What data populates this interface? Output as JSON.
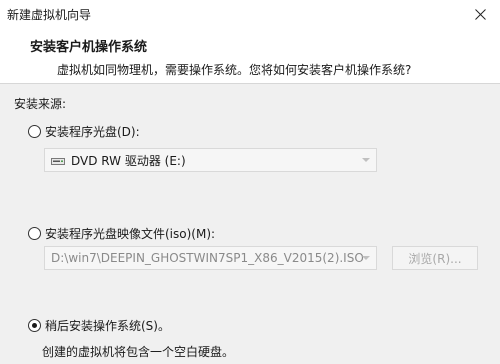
{
  "window": {
    "title": "新建虚拟机向导"
  },
  "header": {
    "title": "安装客户机操作系统",
    "subtitle": "虚拟机如同物理机，需要操作系统。您将如何安装客户机操作系统?"
  },
  "source": {
    "label": "安装来源:",
    "options": [
      {
        "label": "安装程序光盘(D):",
        "selected": false
      },
      {
        "label": "安装程序光盘映像文件(iso)(M):",
        "selected": false
      },
      {
        "label": "稍后安装操作系统(S)。",
        "selected": true
      }
    ],
    "disc_drive": {
      "value": "DVD RW 驱动器 (E:)",
      "icon": "dvd-drive-icon"
    },
    "iso_path": {
      "value": "D:\\win7\\DEEPIN_GHOSTWIN7SP1_X86_V2015(2).ISO"
    },
    "browse_label": "浏览(R)...",
    "later_description": "创建的虚拟机将包含一个空白硬盘。"
  }
}
